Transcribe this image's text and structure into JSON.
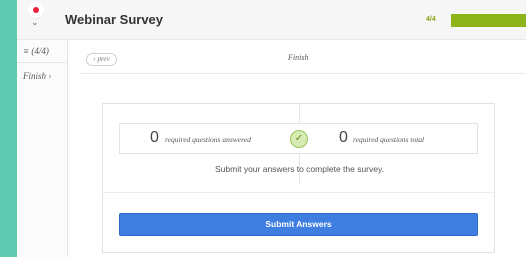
{
  "header": {
    "title": "Webinar Survey",
    "progress_label": "4/4",
    "progress_fraction": 1.0,
    "progress_color": "#8db51b"
  },
  "sidebar": {
    "items": [
      {
        "label": "≡ (4/4)"
      },
      {
        "label": "Finish ›"
      }
    ]
  },
  "nav": {
    "prev_label": "‹ prev",
    "page_name": "Finish"
  },
  "summary": {
    "answered_count": "0",
    "answered_label": "required questions answered",
    "total_count": "0",
    "total_label": "required questions total",
    "check_glyph": "✓",
    "message": "Submit your answers to complete the survey."
  },
  "actions": {
    "submit_label": "Submit Answers",
    "accent_color": "#3d7ee0"
  },
  "icons": {
    "menu": "chevron-down-icon",
    "notification": "red-dot-icon",
    "status": "check-icon"
  }
}
